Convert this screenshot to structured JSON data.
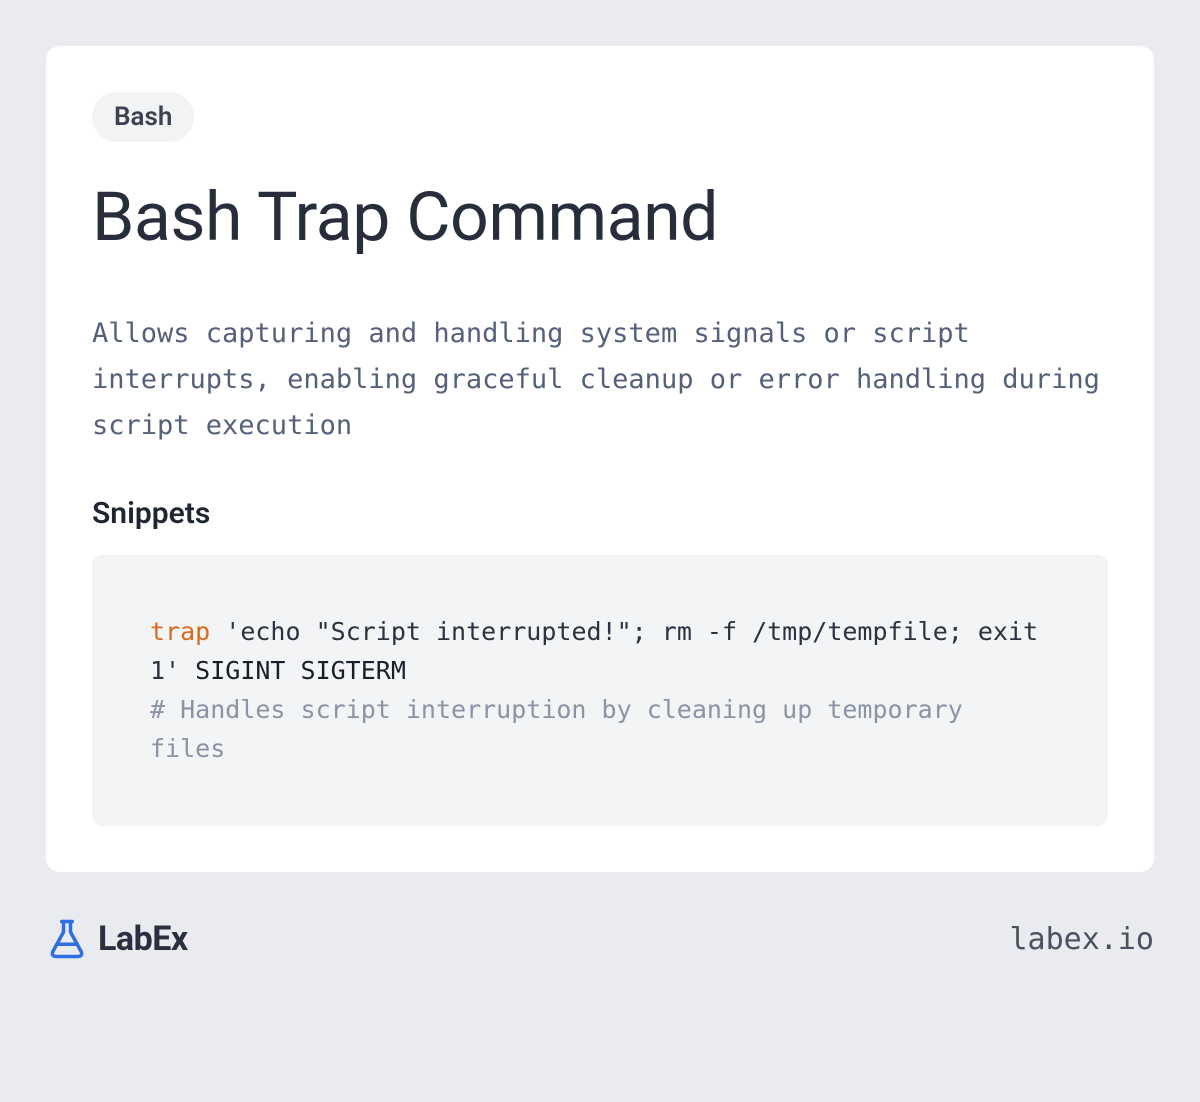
{
  "tag": {
    "label": "Bash"
  },
  "title": "Bash Trap Command",
  "description": "Allows capturing and handling system signals or script interrupts, enabling graceful cleanup or error handling during script execution",
  "snippets": {
    "heading": "Snippets",
    "code": {
      "builtin": "trap",
      "string": "'echo \"Script interrupted!\"; rm -f /tmp/tempfile; exit 1'",
      "args": " SIGINT SIGTERM",
      "comment": "# Handles script interruption by cleaning up temporary files"
    }
  },
  "footer": {
    "brand_name": "LabEx",
    "domain": "labex.io"
  }
}
